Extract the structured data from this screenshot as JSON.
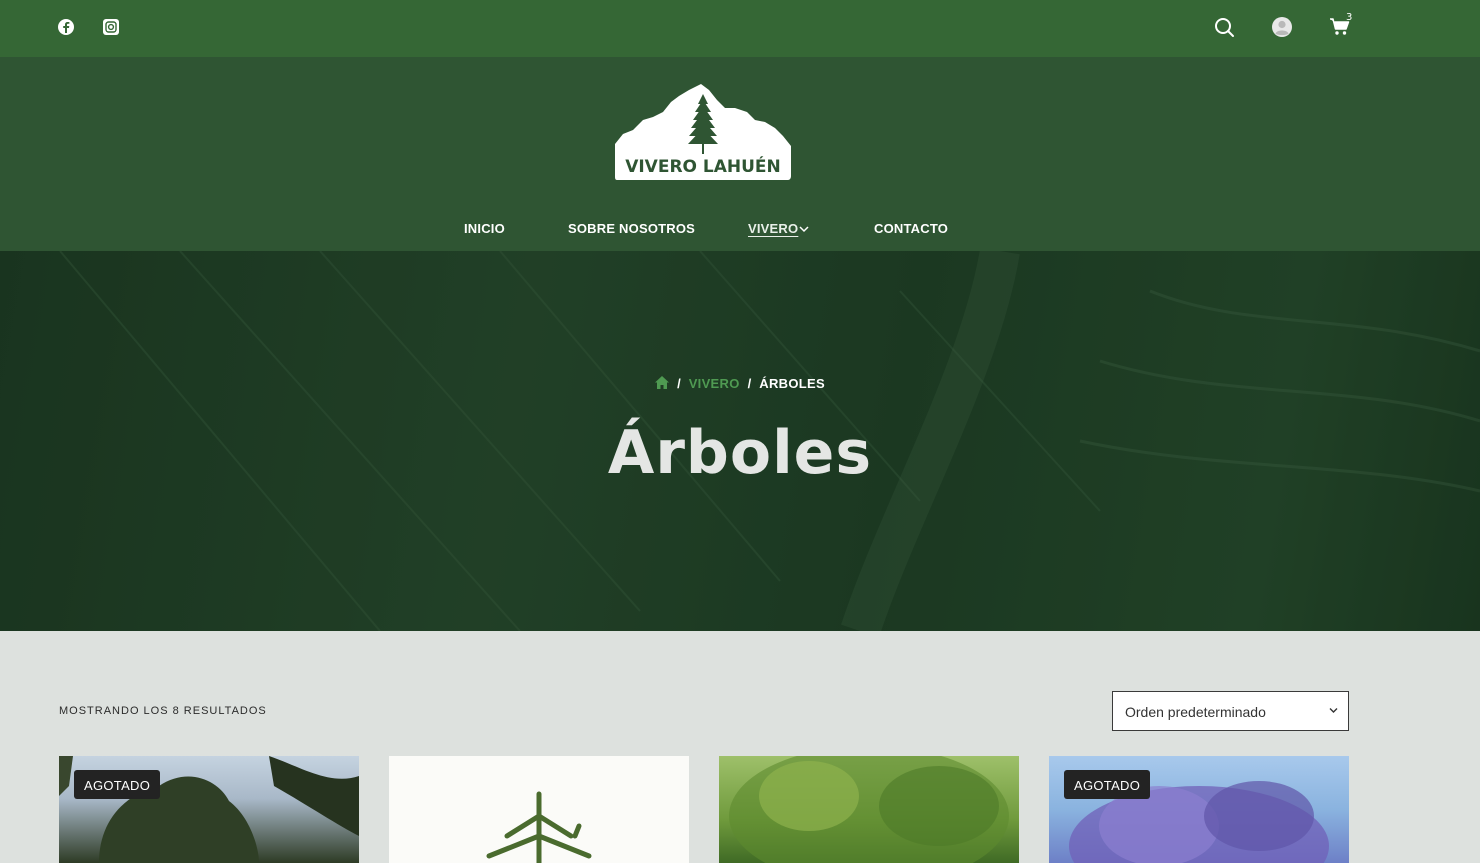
{
  "topbar": {
    "social": [
      {
        "icon": "facebook-icon"
      },
      {
        "icon": "instagram-icon"
      }
    ],
    "tools": [
      {
        "icon": "search-icon"
      },
      {
        "icon": "user-icon"
      },
      {
        "icon": "cart-icon"
      }
    ],
    "cart_count": "3"
  },
  "header": {
    "logo_text": "VIVERO LAHUÉN",
    "nav": {
      "inicio": "INICIO",
      "sobre": "SOBRE NOSOTROS",
      "vivero": "VIVERO",
      "contacto": "CONTACTO"
    }
  },
  "hero": {
    "breadcrumb": {
      "separator": "/",
      "link": "VIVERO",
      "current": "ÁRBOLES"
    },
    "title": "Árboles"
  },
  "shop": {
    "results_text": "MOSTRANDO LOS 8 RESULTADOS",
    "sort_value": "Orden predeterminado",
    "products": [
      {
        "badge": "AGOTADO"
      },
      {
        "badge": ""
      },
      {
        "badge": ""
      },
      {
        "badge": "AGOTADO"
      }
    ]
  },
  "colors": {
    "topbar": "#356735",
    "header": "#2f5533",
    "accent": "#4f9a52",
    "page_bg": "#dde1de"
  }
}
